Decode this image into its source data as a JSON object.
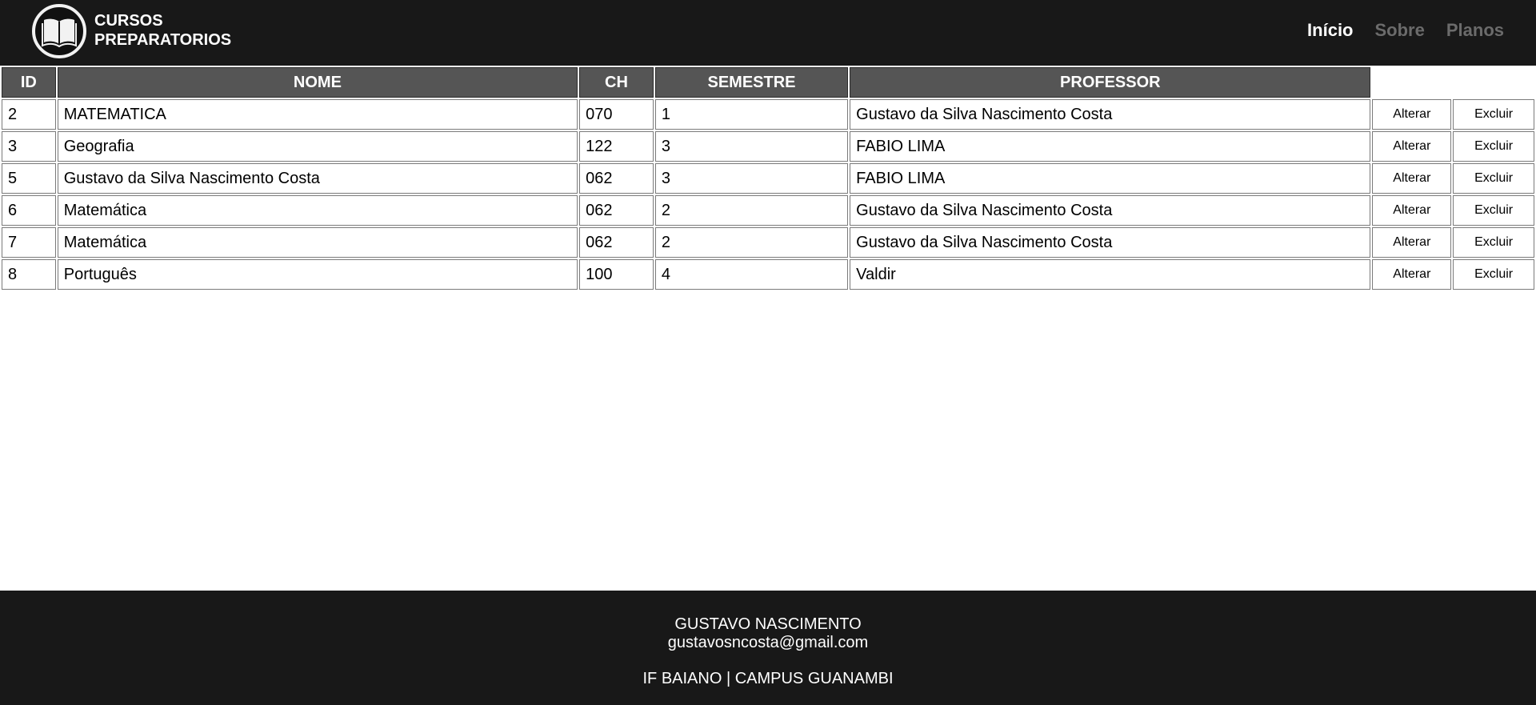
{
  "header": {
    "brand_line1": "CURSOS",
    "brand_line2": "PREPARATORIOS",
    "logo_icon": "open-book-icon",
    "nav": [
      {
        "label": "Início",
        "active": true
      },
      {
        "label": "Sobre",
        "active": false
      },
      {
        "label": "Planos",
        "active": false
      }
    ]
  },
  "table": {
    "columns": [
      "ID",
      "NOME",
      "CH",
      "SEMESTRE",
      "PROFESSOR"
    ],
    "rows": [
      {
        "id": "2",
        "nome": "MATEMATICA",
        "ch": "070",
        "semestre": "1",
        "professor": "Gustavo da Silva Nascimento Costa"
      },
      {
        "id": "3",
        "nome": "Geografia",
        "ch": "122",
        "semestre": "3",
        "professor": "FABIO LIMA"
      },
      {
        "id": "5",
        "nome": "Gustavo da Silva Nascimento Costa",
        "ch": "062",
        "semestre": "3",
        "professor": "FABIO LIMA"
      },
      {
        "id": "6",
        "nome": "Matemática",
        "ch": "062",
        "semestre": "2",
        "professor": "Gustavo da Silva Nascimento Costa"
      },
      {
        "id": "7",
        "nome": "Matemática",
        "ch": "062",
        "semestre": "2",
        "professor": "Gustavo da Silva Nascimento Costa"
      },
      {
        "id": "8",
        "nome": "Português",
        "ch": "100",
        "semestre": "4",
        "professor": "Valdir"
      }
    ],
    "alter_label": "Alterar",
    "delete_label": "Excluir"
  },
  "footer": {
    "name": "GUSTAVO NASCIMENTO",
    "email": "gustavosncosta@gmail.com",
    "institution": "IF BAIANO | CAMPUS GUANAMBI"
  },
  "colors": {
    "header_bg": "#181818",
    "table_header_bg": "#555555",
    "nav_active": "#ffffff",
    "nav_inactive": "#6b6b6b"
  }
}
